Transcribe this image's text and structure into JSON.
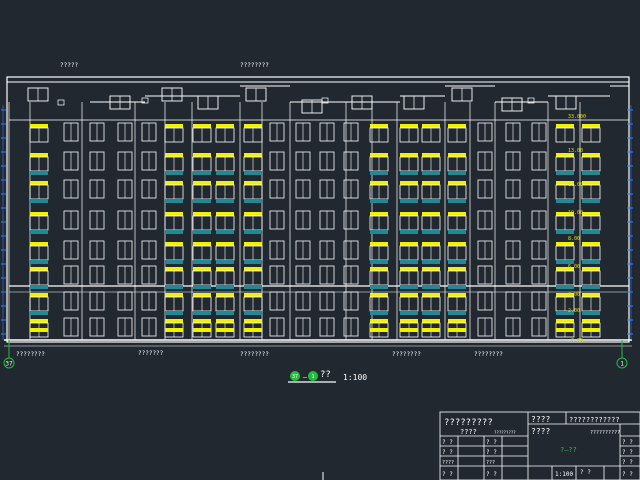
{
  "drawing": {
    "view_title": "??",
    "view_scale": "1:100",
    "axis_start": "37",
    "axis_end": "1",
    "view_axis_start": "37",
    "view_axis_end": "1",
    "view_axis_sep": "—"
  },
  "colors": {
    "background": "#212830",
    "lines": "#ffffff",
    "window_yellow": "#f2f200",
    "window_cyan": "#1f8a96",
    "marker_green": "#1fbf3a",
    "dimension_blue": "#2a7bff",
    "annotation_yellow": "#e0e000"
  },
  "labels": {
    "top_left_note": "?????",
    "top_center_note": "????????",
    "bottom_notes": [
      "????????",
      "???????",
      "????????",
      "????????",
      "????????"
    ]
  },
  "elevations": [
    "33.000",
    "13.00",
    "11.00",
    "19.00",
    "8.00",
    "6.00",
    "3.00",
    "2.00",
    "-0.00"
  ],
  "title_block": {
    "project_title": "?????????",
    "project_sub": "????",
    "stamp": "?????????",
    "drawing_no_1": "????",
    "drawing_no_2": "????",
    "company": "????????????",
    "company_sub": "??????????",
    "drawing_name": "?—??",
    "scale": "1:100",
    "sheet": "? ?",
    "left_rows": [
      "? ?",
      "? ?",
      "????",
      "? ?"
    ],
    "mid_rows": [
      "? ?",
      "? ?",
      "???",
      "? ?"
    ],
    "right_rows": [
      "? ?",
      "? ?",
      "? ?",
      "? ?"
    ]
  }
}
